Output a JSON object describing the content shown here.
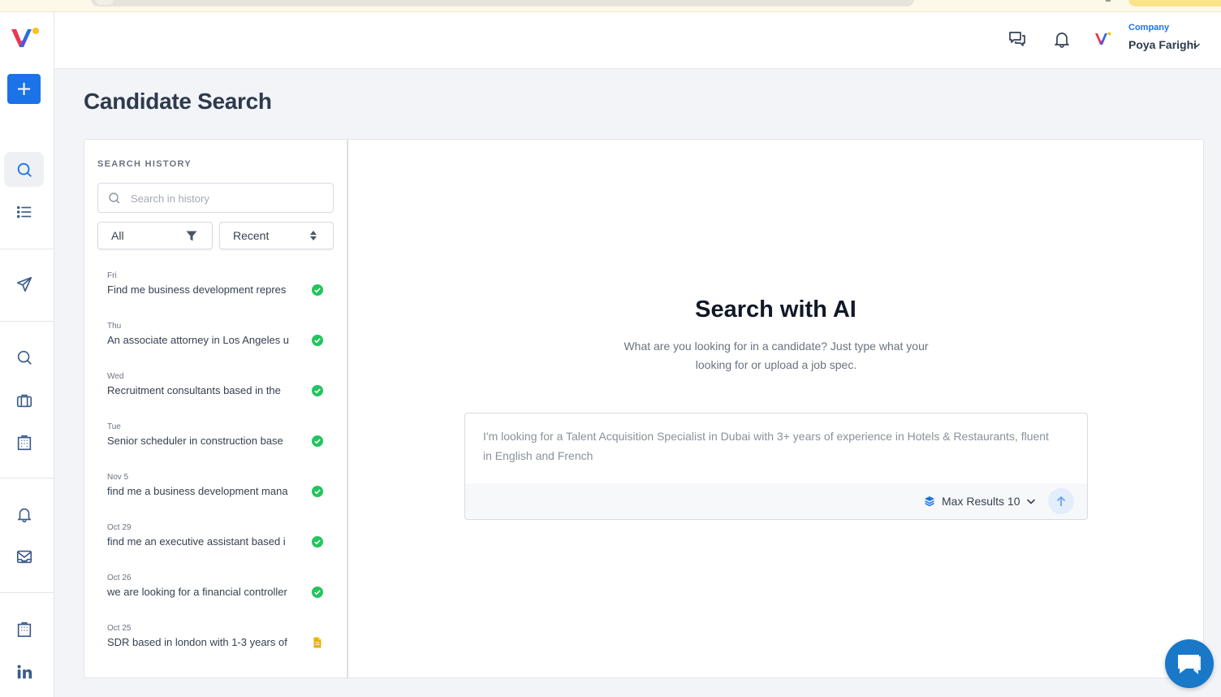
{
  "header": {
    "company_label": "Company",
    "user_name": "Poya Farighi"
  },
  "sidebar": {
    "new_button_label": "+"
  },
  "page": {
    "title": "Candidate Search"
  },
  "history": {
    "title": "SEARCH HISTORY",
    "search_placeholder": "Search in history",
    "filter_value": "All",
    "sort_value": "Recent",
    "items": [
      {
        "date": "Fri",
        "query": "Find me business development repres",
        "status": "complete"
      },
      {
        "date": "Thu",
        "query": "An associate attorney in Los Angeles u",
        "status": "complete"
      },
      {
        "date": "Wed",
        "query": "Recruitment consultants based in the",
        "status": "complete"
      },
      {
        "date": "Tue",
        "query": "Senior scheduler in construction base",
        "status": "complete"
      },
      {
        "date": "Nov 5",
        "query": "find me a business development mana",
        "status": "complete"
      },
      {
        "date": "Oct 29",
        "query": "find me an executive assistant based i",
        "status": "complete"
      },
      {
        "date": "Oct 26",
        "query": "we are looking for a financial controller",
        "status": "complete"
      },
      {
        "date": "Oct 25",
        "query": "SDR based in london with 1-3 years of",
        "status": "document"
      }
    ]
  },
  "main": {
    "heading": "Search with AI",
    "subtitle": "What are you looking for in a candidate? Just type what your looking for or upload a job spec.",
    "prompt_placeholder": "I'm looking for a Talent Acquisition Specialist in Dubai with 3+ years of experience in Hotels & Restaurants, fluent in English and French",
    "max_results_label": "Max Results 10"
  },
  "colors": {
    "accent": "#1a73e8",
    "success": "#22c55e",
    "warning": "#eab308",
    "chat": "#1978c8"
  }
}
